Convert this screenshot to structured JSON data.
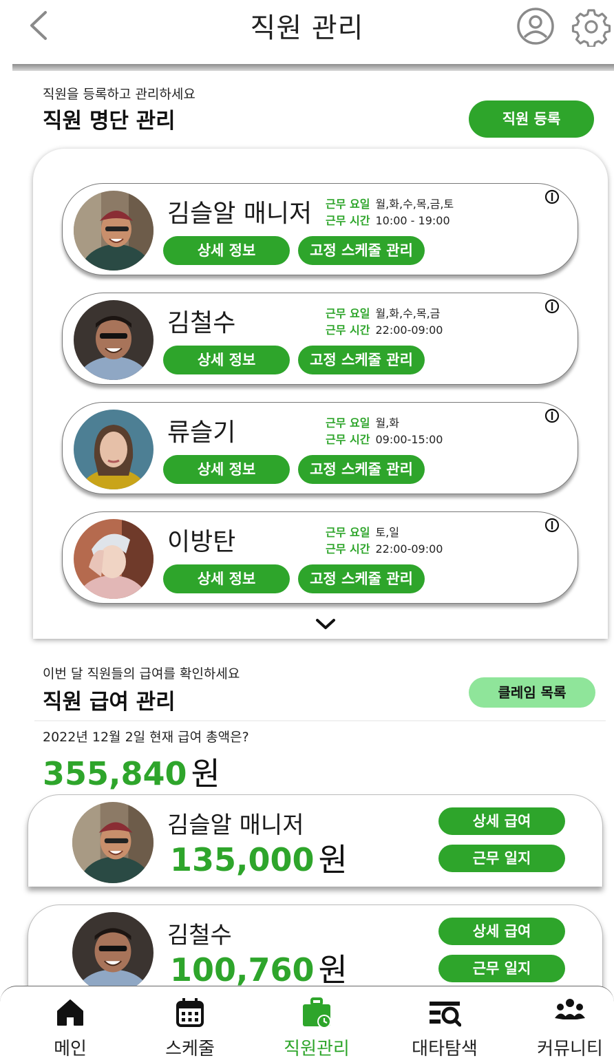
{
  "header": {
    "title": "직원 관리"
  },
  "roster": {
    "subtitle": "직원을 등록하고 관리하세요",
    "title": "직원 명단 관리",
    "register_label": "직원 등록",
    "employees": [
      {
        "name": "김슬알 매니저",
        "days_label": "근무 요일",
        "days": "월,화,수,목,금,토",
        "hours_label": "근무 시간",
        "hours": "10:00 - 19:00",
        "detail_label": "상세 정보",
        "schedule_label": "고정 스케줄 관리"
      },
      {
        "name": "김철수",
        "days_label": "근무 요일",
        "days": "월,화,수,목,금",
        "hours_label": "근무 시간",
        "hours": "22:00-09:00",
        "detail_label": "상세 정보",
        "schedule_label": "고정 스케줄 관리"
      },
      {
        "name": "류슬기",
        "days_label": "근무 요일",
        "days": "월,화",
        "hours_label": "근무 시간",
        "hours": "09:00-15:00",
        "detail_label": "상세 정보",
        "schedule_label": "고정 스케줄 관리"
      },
      {
        "name": "이방탄",
        "days_label": "근무 요일",
        "days": "토,일",
        "hours_label": "근무 시간",
        "hours": "22:00-09:00",
        "detail_label": "상세 정보",
        "schedule_label": "고정 스케줄 관리"
      }
    ]
  },
  "payroll": {
    "subtitle": "이번 달 직원들의 급여를 확인하세요",
    "title": "직원 급여 관리",
    "claims_label": "클레임 목록",
    "total_question": "2022년 12월 2일 현재 급여 총액은?",
    "total_amount": "355,840",
    "currency": "원",
    "entries": [
      {
        "name": "김슬알 매니저",
        "amount": "135,000",
        "detail_label": "상세 급여",
        "log_label": "근무 일지"
      },
      {
        "name": "김철수",
        "amount": "100,760",
        "detail_label": "상세 급여",
        "log_label": "근무 일지"
      }
    ]
  },
  "nav": [
    {
      "label": "메인",
      "icon": "home-icon"
    },
    {
      "label": "스케줄",
      "icon": "calendar-icon"
    },
    {
      "label": "직원관리",
      "icon": "briefcase-clock-icon",
      "active": true
    },
    {
      "label": "대타탐색",
      "icon": "list-search-icon"
    },
    {
      "label": "커뮤니티",
      "icon": "people-icon"
    }
  ],
  "colors": {
    "accent": "#2ea52b",
    "accent_light": "#8fe59a"
  }
}
